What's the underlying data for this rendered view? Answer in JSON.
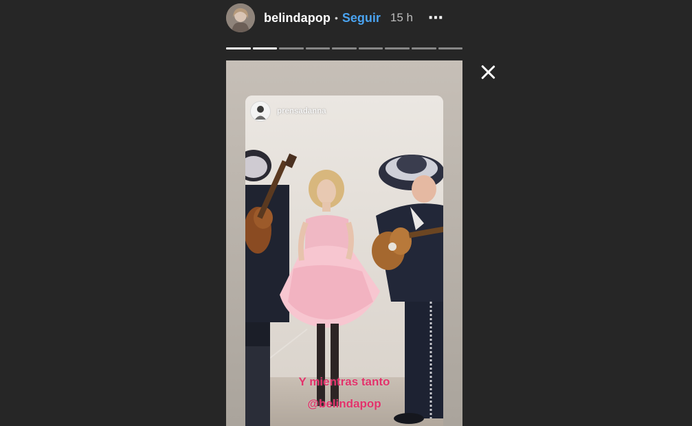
{
  "header": {
    "username": "belindapop",
    "separator": "•",
    "follow_label": "Seguir",
    "time_ago": "15 h",
    "more_icon": "⋯"
  },
  "progress": {
    "segments_total": 9,
    "segments_done": 2
  },
  "story": {
    "repost_username": "prensadanna",
    "caption_line1": "Y mientras tanto",
    "caption_line2": "@belindapop"
  },
  "colors": {
    "background": "#262626",
    "follow": "#4aa3f0",
    "caption": "#e2336b"
  }
}
